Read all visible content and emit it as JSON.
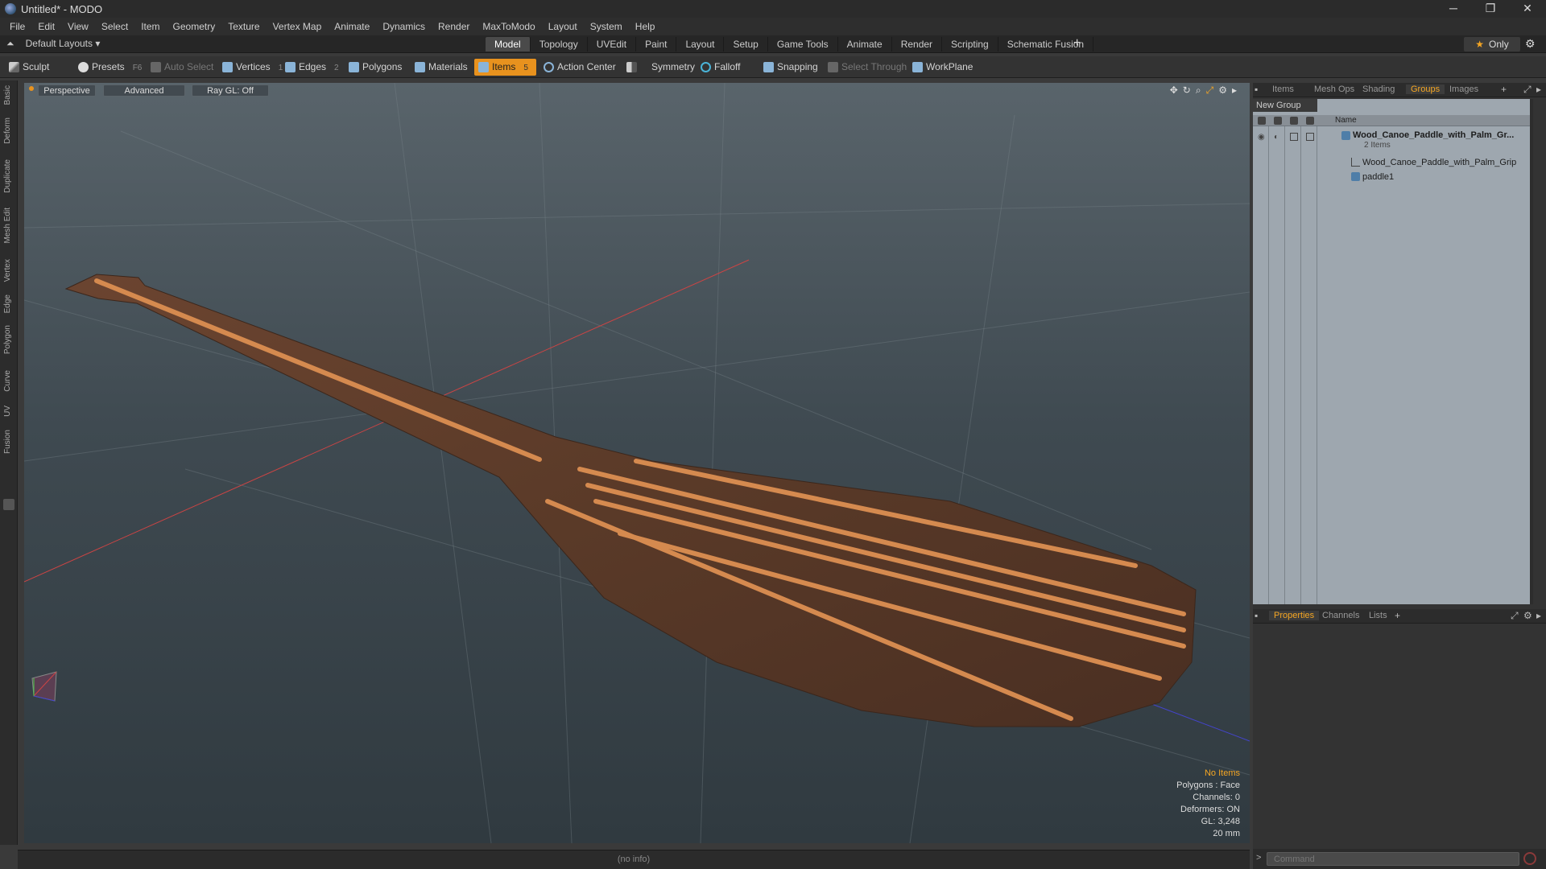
{
  "window": {
    "title": "Untitled* - MODO",
    "controls": [
      "─",
      "❐",
      "✕"
    ]
  },
  "menu": [
    "File",
    "Edit",
    "View",
    "Select",
    "Item",
    "Geometry",
    "Texture",
    "Vertex Map",
    "Animate",
    "Dynamics",
    "Render",
    "MaxToModo",
    "Layout",
    "System",
    "Help"
  ],
  "layoutbar": {
    "layout_select": "Default Layouts ▾",
    "tabs": [
      "Model",
      "Topology",
      "UVEdit",
      "Paint",
      "Layout",
      "Setup",
      "Game Tools",
      "Animate",
      "Render",
      "Scripting",
      "Schematic Fusion"
    ],
    "active_tab": "Model",
    "plus": "+",
    "only_label": "Only",
    "star": "★"
  },
  "toolbar": {
    "sculpt": "Sculpt",
    "presets": "Presets",
    "presets_key": "F6",
    "auto_select": "Auto Select",
    "vertices": "Vertices",
    "vertices_key": "1",
    "edges": "Edges",
    "edges_key": "2",
    "polygons": "Polygons",
    "materials": "Materials",
    "items": "Items",
    "items_key": "5",
    "action_center": "Action Center",
    "symmetry": "Symmetry",
    "falloff": "Falloff",
    "snapping": "Snapping",
    "select_through": "Select Through",
    "workplane": "WorkPlane"
  },
  "left_tabs": [
    "Basic",
    "Deform",
    "Duplicate",
    "Mesh Edit",
    "Vertex",
    "Edge",
    "Polygon",
    "Curve",
    "UV",
    "Fusion"
  ],
  "viewport": {
    "view_mode": "Perspective",
    "shading": "Advanced",
    "raygl": "Ray GL: Off",
    "info": {
      "head": "No Items",
      "polygons": "Polygons : Face",
      "channels": "Channels: 0",
      "deformers": "Deformers: ON",
      "gl": "GL: 3,248",
      "scale": "20 mm"
    }
  },
  "statusbar": {
    "text": "(no info)"
  },
  "right_top_tabs": [
    "Items",
    "Mesh Ops",
    "Shading",
    "Groups",
    "Images"
  ],
  "right_top_active": "Groups",
  "groups": {
    "new_group": "New Group",
    "col_name": "Name",
    "group_name": "Wood_Canoe_Paddle_with_Palm_Gr...",
    "group_count": "2 Items",
    "children": [
      "Wood_Canoe_Paddle_with_Palm_Grip",
      "paddle1"
    ]
  },
  "right_bottom_tabs": [
    "Properties",
    "Channels",
    "Lists"
  ],
  "right_bottom_active": "Properties",
  "command": {
    "placeholder": "Command",
    "prompt": ">"
  },
  "colors": {
    "accent": "#f5a623",
    "items_active": "#e8921e",
    "tree_bg": "#9ea7af"
  }
}
